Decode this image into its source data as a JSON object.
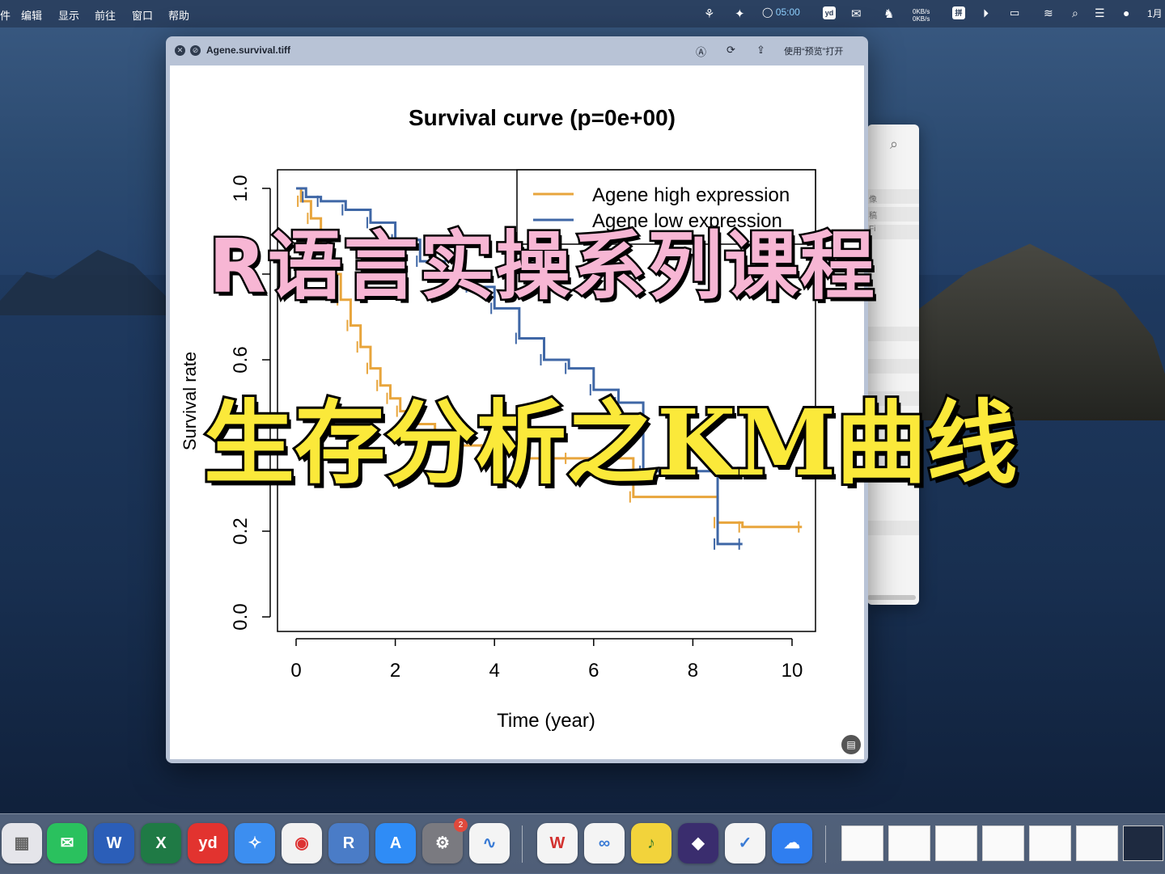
{
  "menubar": {
    "items": [
      "件",
      "编辑",
      "显示",
      "前往",
      "窗口",
      "帮助"
    ],
    "time": "05:00",
    "net_up": "0KB/s",
    "net_down": "0KB/s",
    "ime": "拼",
    "date": "1月"
  },
  "window": {
    "title": "Agene.survival.tiff",
    "open_with": "使用“预览”打开"
  },
  "back_window": {
    "labels": [
      "像",
      "稿",
      "Fi"
    ]
  },
  "overlay": {
    "line1": "R语言实操系列课程",
    "line2": "生存分析之KM曲线"
  },
  "chart_data": {
    "type": "line",
    "title": "Survival curve (p=0e+00)",
    "xlabel": "Time (year)",
    "ylabel": "Survival rate",
    "xlim": [
      0,
      10.5
    ],
    "ylim": [
      0,
      1.0
    ],
    "xticks": [
      "0",
      "2",
      "4",
      "6",
      "8",
      "10"
    ],
    "yticks": [
      "0.0",
      "0.2",
      "0.6",
      "1.0"
    ],
    "legend_position": "top-right",
    "legend": [
      "Agene high expression",
      "Agene low expression"
    ],
    "series": [
      {
        "name": "Agene high expression",
        "color": "#e8a53c",
        "x": [
          0,
          0.1,
          0.3,
          0.5,
          0.7,
          0.9,
          1.1,
          1.3,
          1.5,
          1.7,
          1.9,
          2.1,
          2.4,
          2.8,
          3.3,
          3.8,
          4.5,
          5.5,
          6.8,
          8.5,
          9.0,
          10.2
        ],
        "y": [
          1.0,
          0.97,
          0.93,
          0.86,
          0.8,
          0.74,
          0.68,
          0.63,
          0.58,
          0.54,
          0.51,
          0.48,
          0.45,
          0.42,
          0.4,
          0.39,
          0.37,
          0.37,
          0.28,
          0.22,
          0.21,
          0.21
        ]
      },
      {
        "name": "Agene low expression",
        "color": "#3f67a6",
        "x": [
          0,
          0.2,
          0.5,
          1.0,
          1.5,
          2.0,
          2.5,
          3.0,
          3.5,
          4.0,
          4.5,
          5.0,
          5.5,
          6.0,
          6.5,
          7.0,
          8.5,
          9.0
        ],
        "y": [
          1.0,
          0.98,
          0.97,
          0.95,
          0.92,
          0.88,
          0.83,
          0.8,
          0.77,
          0.72,
          0.65,
          0.6,
          0.58,
          0.53,
          0.5,
          0.34,
          0.17,
          0.17
        ]
      }
    ]
  }
}
